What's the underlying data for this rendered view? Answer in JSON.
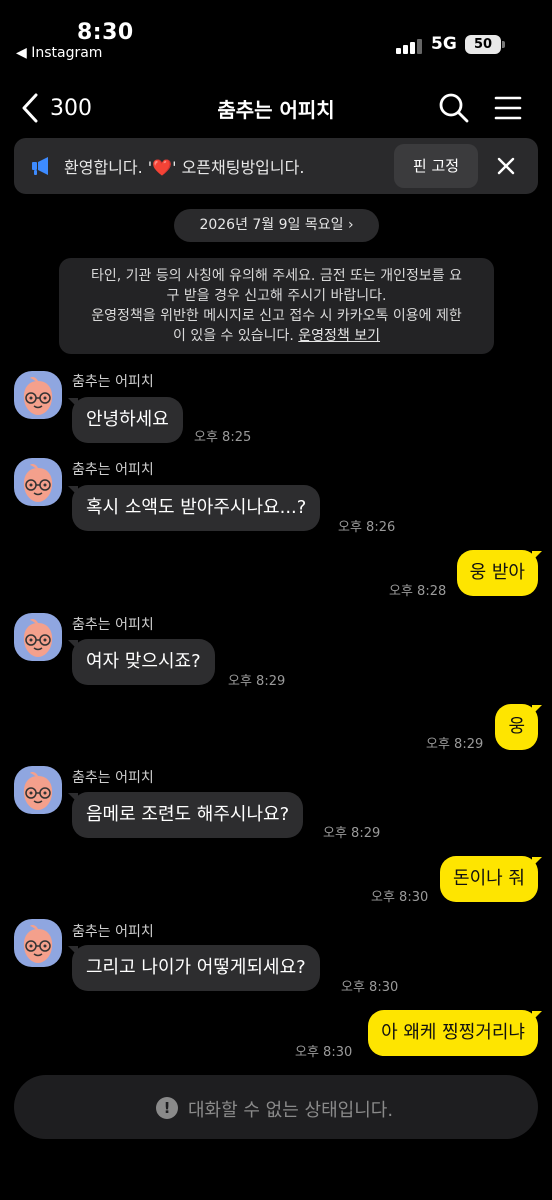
{
  "status_bar": {
    "time": "8:30",
    "back_app": "◀ Instagram",
    "network": "5G",
    "battery": "50"
  },
  "nav": {
    "back_count": "300",
    "title": "춤추는 어피치"
  },
  "notice": {
    "text": "환영합니다. '❤️' 오픈채팅방입니다.",
    "pin_label": "핀 고정"
  },
  "date_pill": "2026년 7월 9일 목요일 ›",
  "system_message": {
    "line1": "타인, 기관 등의 사칭에 유의해 주세요. 금전 또는 개인정보를 요",
    "line2": "구 받을 경우 신고해 주시기 바랍니다.",
    "line3": "운영정책을 위반한 메시지로 신고 접수 시 카카오톡 이용에 제한",
    "line4": "이 있을 수 있습니다.",
    "link": "운영정책 보기"
  },
  "messages": [
    {
      "direction": "in",
      "sender": "춤추는 어피치",
      "text": "안녕하세요",
      "time": "오후 8:25"
    },
    {
      "direction": "in",
      "sender": "춤추는 어피치",
      "text": "혹시 소액도 받아주시나요...?",
      "time": "오후 8:26"
    },
    {
      "direction": "out",
      "text": "웅 받아",
      "time": "오후 8:28"
    },
    {
      "direction": "in",
      "sender": "춤추는 어피치",
      "text": "여자 맞으시죠?",
      "time": "오후 8:29"
    },
    {
      "direction": "out",
      "text": "웅",
      "time": "오후 8:29"
    },
    {
      "direction": "in",
      "sender": "춤추는 어피치",
      "text": "음메로 조련도 해주시나요?",
      "time": "오후 8:29"
    },
    {
      "direction": "out",
      "text": "돈이나 줘",
      "time": "오후 8:30"
    },
    {
      "direction": "in",
      "sender": "춤추는 어피치",
      "text": "그리고 나이가 어떻게되세요?",
      "time": "오후 8:30"
    },
    {
      "direction": "out",
      "text": "아 왜케 찡찡거리냐",
      "time": "오후 8:30"
    }
  ],
  "bottom_bar": {
    "text": "대화할 수 없는 상태입니다."
  },
  "colors": {
    "background": "#000000",
    "incoming_bubble": "#2d2d2f",
    "outgoing_bubble": "#fee500",
    "avatar_bg": "#8fa6e0",
    "megaphone": "#3d8bff"
  }
}
